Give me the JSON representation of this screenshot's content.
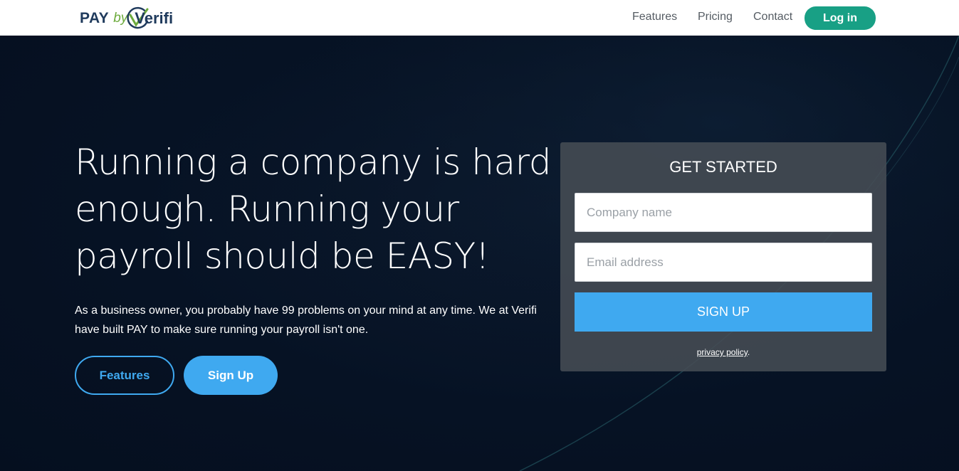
{
  "header": {
    "logo": {
      "pay": "PAY",
      "by": "by",
      "verifi": "Verifi"
    },
    "nav": [
      {
        "label": "Features"
      },
      {
        "label": "Pricing"
      },
      {
        "label": "Contact"
      }
    ],
    "login_label": "Log in"
  },
  "hero": {
    "headline": "Running a company is hard enough. Running your payroll should be EASY!",
    "subtext": "As a business owner, you probably have 99 problems on your mind at any time. We at Verifi have built PAY to make sure running your payroll isn't one.",
    "features_button": "Features",
    "signup_button": "Sign Up"
  },
  "signup_form": {
    "title": "GET STARTED",
    "company_placeholder": "Company name",
    "company_value": "",
    "email_placeholder": "Email address",
    "email_value": "",
    "submit_label": "SIGN UP",
    "privacy_link": "privacy policy",
    "privacy_suffix": "."
  },
  "colors": {
    "accent_blue": "#3fa9f0",
    "login_green": "#18a085",
    "logo_navy": "#1f3a5c",
    "logo_green": "#6dab3d",
    "hero_bg": "#071426"
  }
}
